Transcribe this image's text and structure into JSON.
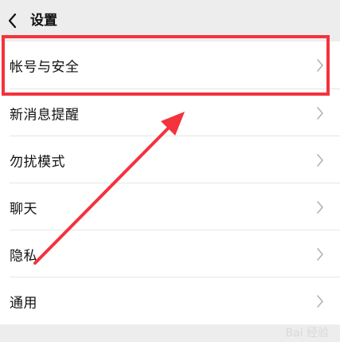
{
  "header": {
    "title": "设置"
  },
  "settings": {
    "items": [
      {
        "label": "帐号与安全"
      },
      {
        "label": "新消息提醒"
      },
      {
        "label": "勿扰模式"
      },
      {
        "label": "聊天"
      },
      {
        "label": "隐私"
      },
      {
        "label": "通用"
      }
    ]
  },
  "annotation": {
    "highlight_color": "#f4333c"
  },
  "icons": {
    "back": "chevron-left-icon",
    "row": "chevron-right-icon"
  },
  "watermark": {
    "text": "Bai 经验"
  }
}
